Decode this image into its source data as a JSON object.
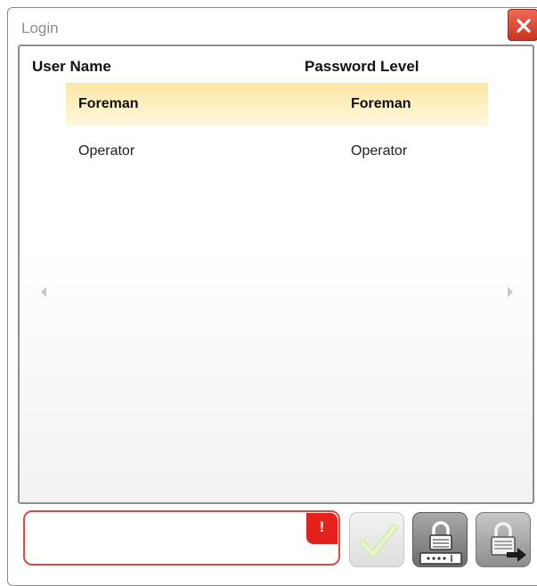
{
  "window": {
    "title": "Login"
  },
  "grid": {
    "columns": [
      "User Name",
      "Password Level"
    ],
    "rows": [
      {
        "user": "Foreman",
        "level": "Foreman",
        "selected": true
      },
      {
        "user": "Operator",
        "level": "Operator",
        "selected": false
      }
    ]
  },
  "password": {
    "value": "",
    "error_label": "!"
  },
  "colors": {
    "selected_row": "#fde7a6",
    "error": "#e5211d",
    "close_button": "#d9472f"
  },
  "icons": {
    "close": "close-icon",
    "confirm": "checkmark-icon",
    "lock": "padlock-icon",
    "logout": "logout-icon",
    "scroll_left": "scroll-left-icon",
    "scroll_right": "scroll-right-icon"
  }
}
